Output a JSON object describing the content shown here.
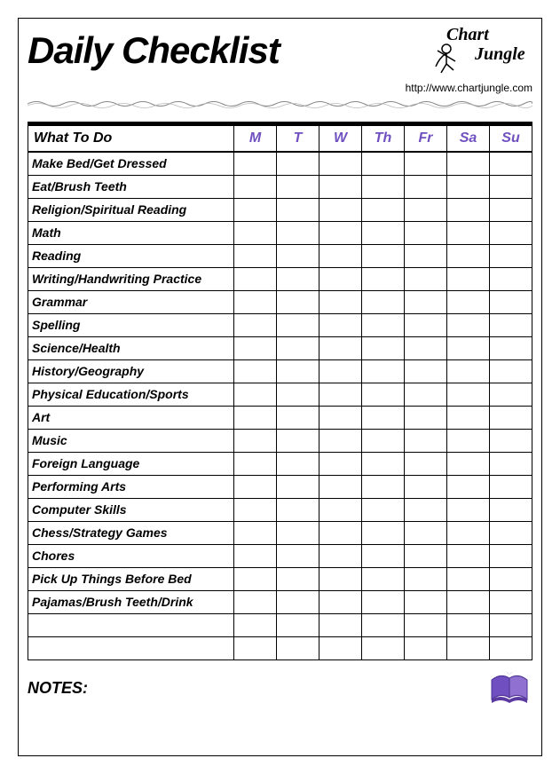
{
  "header": {
    "title": "Daily Checklist",
    "url": "http://www.chartjungle.com"
  },
  "table": {
    "task_header": "What To Do",
    "days": [
      "M",
      "T",
      "W",
      "Th",
      "Fr",
      "Sa",
      "Su"
    ],
    "tasks": [
      "Make Bed/Get Dressed",
      "Eat/Brush Teeth",
      "Religion/Spiritual Reading",
      "Math",
      "Reading",
      "Writing/Handwriting Practice",
      "Grammar",
      "Spelling",
      "Science/Health",
      "History/Geography",
      "Physical Education/Sports",
      "Art",
      "Music",
      "Foreign Language",
      "Performing Arts",
      "Computer Skills",
      "Chess/Strategy Games",
      "Chores",
      "Pick Up Things Before Bed",
      "Pajamas/Brush Teeth/Drink",
      "",
      ""
    ]
  },
  "footer": {
    "notes_label": "NOTES:"
  }
}
